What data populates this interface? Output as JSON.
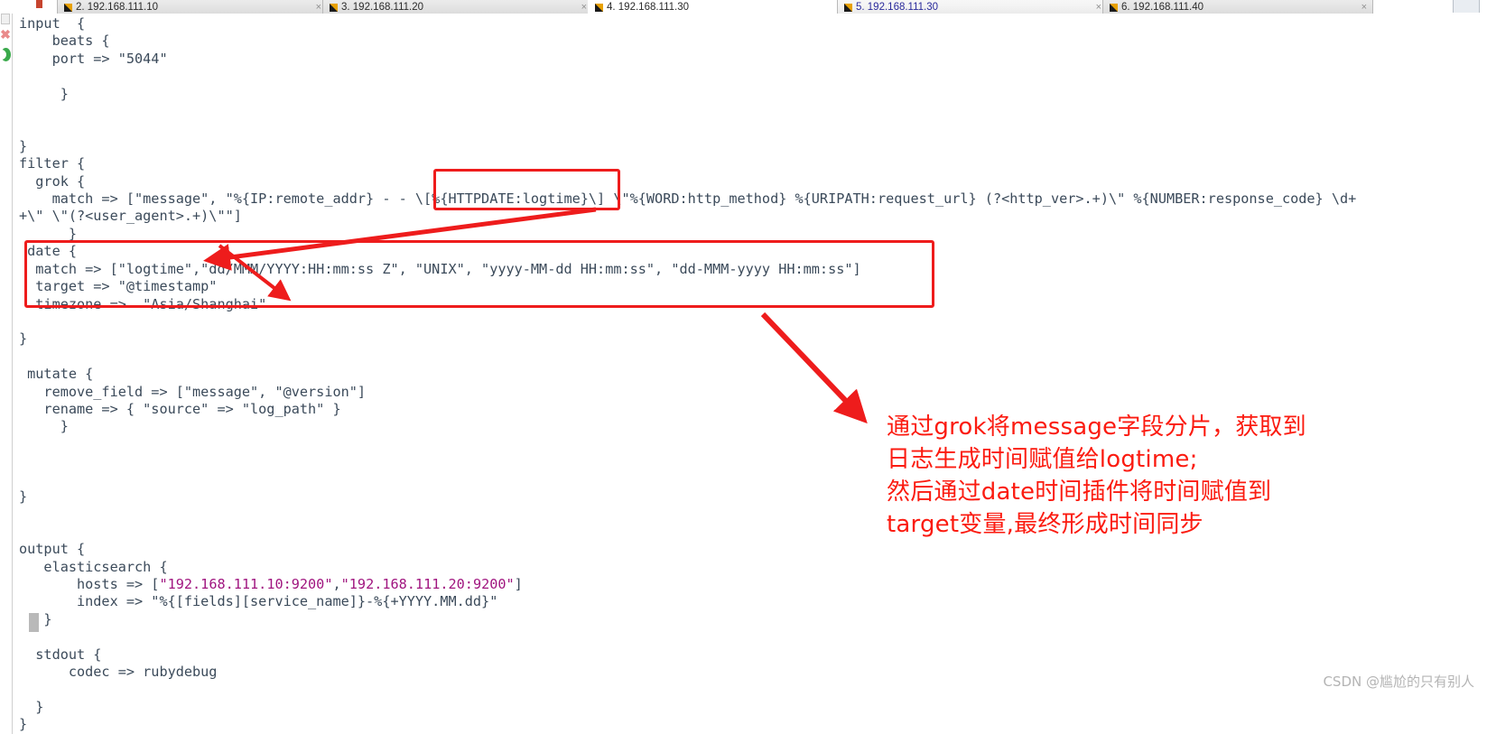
{
  "window": {
    "tabs": [
      {
        "label": "2. 192.168.111.10",
        "active": false,
        "close_glyph": "×"
      },
      {
        "label": "3. 192.168.111.20",
        "active": false,
        "close_glyph": "×"
      },
      {
        "label": "4. 192.168.111.30",
        "active": false,
        "close_glyph": "×"
      },
      {
        "label": "5. 192.168.111.30",
        "active": true,
        "close_glyph": "×"
      },
      {
        "label": "6. 192.168.111.40",
        "active": false,
        "close_glyph": "×"
      }
    ],
    "new_tab_label": "+"
  },
  "rail": {
    "error_icon": "✖",
    "ok_icon": "●"
  },
  "editor": {
    "language": "logstash-conf",
    "lines": [
      "input  {",
      "    beats {",
      "    port => \"5044\"",
      "",
      "     }",
      "",
      "",
      "}",
      "filter {",
      "  grok {",
      "    match => [\"message\", \"%{IP:remote_addr} - - \\[%{HTTPDATE:logtime}\\] \\\"%{WORD:http_method} %{URIPATH:request_url} (?<http_ver>.+)\\\" %{NUMBER:response_code} \\d+",
      "+\\\" \\\"(?<user_agent>.+)\\\"\"]",
      "      }",
      " date {",
      "  match => [\"logtime\",\"dd/MMM/YYYY:HH:mm:ss Z\", \"UNIX\", \"yyyy-MM-dd HH:mm:ss\", \"dd-MMM-yyyy HH:mm:ss\"]",
      "  target => \"@timestamp\"",
      "  timezone =>  \"Asia/Shanghai\"",
      "",
      "}",
      "",
      " mutate {",
      "   remove_field => [\"message\", \"@version\"]",
      "   rename => { \"source\" => \"log_path\" }",
      "     }",
      "",
      "",
      "",
      "}",
      "",
      "",
      "output {",
      "   elasticsearch {",
      "       hosts => [\"192.168.111.10:9200\",\"192.168.111.20:9200\"]",
      "       index => \"%{[fields][service_name]}-%{+YYYY.MM.dd}\"",
      "   }",
      "",
      "  stdout {",
      "      codec => rubydebug",
      "",
      "  }",
      "}"
    ],
    "highlighted_strings": [
      "192.168.111.10:9200",
      "192.168.111.20:9200"
    ]
  },
  "annotations": {
    "box_grok_label": "grok-httpdate-logtime-highlight",
    "box_date_label": "date-filter-block-highlight",
    "note_text": "通过grok将message字段分片，获取到\n日志生成时间赋值给logtime;\n然后通过date时间插件将时间赋值到\ntarget变量,最终形成时间同步",
    "color": "#fb1b10"
  },
  "watermark": {
    "text": "CSDN @尴尬的只有别人",
    "color": "#b4b4b4"
  }
}
